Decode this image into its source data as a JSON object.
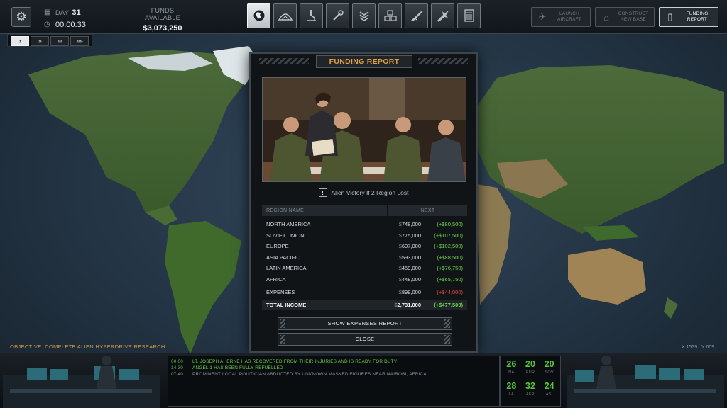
{
  "hud": {
    "day_label": "DAY",
    "day_value": "31",
    "clock": "00:00:33",
    "funds_label": "FUNDS AVAILABLE",
    "funds_value": "$3,073,250"
  },
  "nav_tabs": [
    {
      "icon": "globe-icon",
      "active": true
    },
    {
      "icon": "hangar-icon",
      "active": false
    },
    {
      "icon": "microscope-icon",
      "active": false
    },
    {
      "icon": "wrench-icon",
      "active": false
    },
    {
      "icon": "rank-chevron-icon",
      "active": false
    },
    {
      "icon": "base-grid-icon",
      "active": false
    },
    {
      "icon": "rifle-icon",
      "active": false
    },
    {
      "icon": "jet-icon",
      "active": false
    },
    {
      "icon": "server-icon",
      "active": false
    }
  ],
  "right_buttons": [
    {
      "name": "launch-aircraft-button",
      "icon": "plane-icon",
      "line1": "LAUNCH",
      "line2": "AIRCRAFT",
      "active": false
    },
    {
      "name": "construct-base-button",
      "icon": "crane-icon",
      "line1": "CONSTRUCT",
      "line2": "NEW BASE",
      "active": false
    },
    {
      "name": "funding-report-button",
      "icon": "phone-icon",
      "line1": "FUNDING",
      "line2": "REPORT",
      "active": true
    }
  ],
  "speed": [
    {
      "label": "›",
      "active": true
    },
    {
      "label": "››",
      "active": false
    },
    {
      "label": "›››",
      "active": false
    },
    {
      "label": "››››",
      "active": false
    }
  ],
  "report": {
    "title": "FUNDING REPORT",
    "warning": "Alien Victory If 2 Region Lost",
    "col_region": "REGION NAME",
    "col_next": "NEXT",
    "currency_sign": "$",
    "rows": [
      {
        "name": "NORTH AMERICA",
        "amount": "748,000",
        "delta": "(+$80,500)"
      },
      {
        "name": "SOVIET UNION",
        "amount": "775,000",
        "delta": "(+$107,500)"
      },
      {
        "name": "EUROPE",
        "amount": "607,000",
        "delta": "(+$102,500)"
      },
      {
        "name": "ASIA PACIFIC",
        "amount": "593,000",
        "delta": "(+$88,500)"
      },
      {
        "name": "LATIN AMERICA",
        "amount": "459,000",
        "delta": "(+$76,750)"
      },
      {
        "name": "AFRICA",
        "amount": "448,000",
        "delta": "(+$65,750)"
      }
    ],
    "expenses": {
      "name": "EXPENSES",
      "amount": "899,000",
      "delta": "(+$44,000)"
    },
    "total": {
      "name": "TOTAL INCOME",
      "amount": "2,731,000",
      "delta": "(+$477,500)"
    },
    "show_expenses_label": "SHOW EXPENSES REPORT",
    "close_label": "CLOSE"
  },
  "objective": "OBJECTIVE: COMPLETE ALIEN HYPERDRIVE RESEARCH",
  "coords": "X 1539 : Y 609",
  "log": [
    {
      "time": "00:00",
      "msg": "LT. JOSEPH AHERNE HAS RECOVERED FROM THEIR INJURIES AND IS READY FOR DUTY",
      "dim": false
    },
    {
      "time": "14:30",
      "msg": "ANGEL 1 HAS BEEN FULLY REFUELLED",
      "dim": false
    },
    {
      "time": "07:40",
      "msg": "PROMINENT LOCAL POLITICIAN ABDUCTED BY UNKNOWN MASKED FIGURES NEAR NAIROBI, AFRICA",
      "dim": true
    }
  ],
  "region_counts": [
    {
      "n": "26",
      "r": "NA"
    },
    {
      "n": "20",
      "r": "EUR"
    },
    {
      "n": "20",
      "r": "SOV"
    },
    {
      "n": "28",
      "r": "LA"
    },
    {
      "n": "32",
      "r": "AFR"
    },
    {
      "n": "24",
      "r": "ASI"
    }
  ],
  "colors": {
    "accent_orange": "#e2a043",
    "positive_green": "#6cd34b",
    "negative_red": "#e0473f",
    "log_green": "#57c53b"
  }
}
